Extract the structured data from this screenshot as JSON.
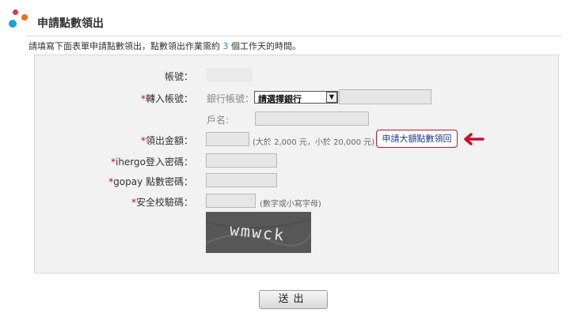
{
  "header": {
    "title": "申請點數領出",
    "logo_colors": [
      "#1aa3d9",
      "#f26b1d",
      "#e2334a"
    ]
  },
  "description": {
    "prefix": "請填寫下面表單申請點數領出，點數領出作業需約 ",
    "days": "3",
    "suffix": " 個工作天的時間。"
  },
  "form": {
    "account_label": "帳號：",
    "transfer_label": "轉入帳號：",
    "bank_account_label": "銀行帳號：",
    "bank_select_value": "請選擇銀行",
    "account_name_label": "戶名:",
    "amount_label": "領出金額：",
    "amount_hint": "(大於 2,000 元，小於 20,000 元)",
    "large_amount_link": "申請大額點數領回",
    "ihergo_password_label": "ihergo登入密碼：",
    "gopay_password_label": "gopay 點數密碼：",
    "captcha_label": "安全校驗碼：",
    "captcha_hint": "(數字或小寫字母)",
    "captcha_text": "wmwck",
    "required_mark": "*"
  },
  "submit_label": "送出",
  "colors": {
    "required": "#d0021b",
    "link": "#1a3e8a",
    "highlight": "#c8102e"
  }
}
